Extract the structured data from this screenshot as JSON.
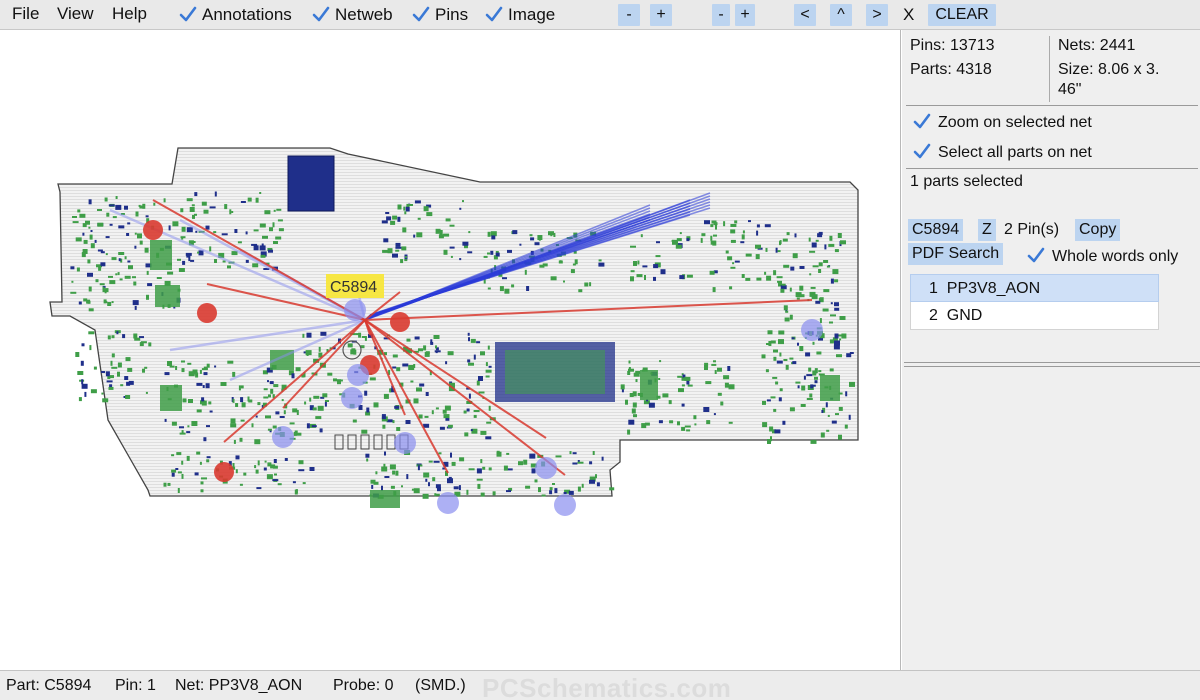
{
  "menu": {
    "file": "File",
    "view": "View",
    "help": "Help"
  },
  "toolbar": {
    "annotations": "Annotations",
    "netweb": "Netweb",
    "pins": "Pins",
    "image": "Image",
    "zoom_out_1": "-",
    "zoom_in_1": "+",
    "zoom_out_2": "-",
    "zoom_in_2": "+",
    "left": "<",
    "up": "^",
    "right": ">",
    "x": "X",
    "clear": "CLEAR"
  },
  "stats": {
    "pins": "Pins: 13713",
    "parts": "Parts: 4318",
    "nets": "Nets: 2441",
    "size_line1": "Size: 8.06 x 3.",
    "size_line2": "46\""
  },
  "options": {
    "zoom_on_net": "Zoom on selected net",
    "select_all_parts": "Select all parts on net",
    "parts_selected": "1 parts selected"
  },
  "part": {
    "name": "C5894",
    "z_label": "Z",
    "pin_count": "2 Pin(s)",
    "copy_label": "Copy",
    "pdf_search_label": "PDF Search",
    "whole_words": "Whole words only",
    "pins": [
      {
        "num": "1",
        "net": "PP3V8_AON",
        "selected": true
      },
      {
        "num": "2",
        "net": "GND",
        "selected": false
      }
    ]
  },
  "board": {
    "highlight_label": "C5894",
    "colors": {
      "board_fill": "#eeeeee",
      "board_stroke": "#444444",
      "part_green": "#3f9e48",
      "part_navy": "#1f2f8a",
      "net_red": "#d93a30",
      "net_blue": "#2a3ad8",
      "net_light": "#8a8ff0",
      "label_bg": "#f7e63a"
    }
  },
  "status": {
    "part": "Part: C5894",
    "pin": "Pin: 1",
    "net": "Net: PP3V8_AON",
    "probe": "Probe: 0",
    "type": "(SMD.)",
    "watermark": "PCSchematics.com"
  }
}
